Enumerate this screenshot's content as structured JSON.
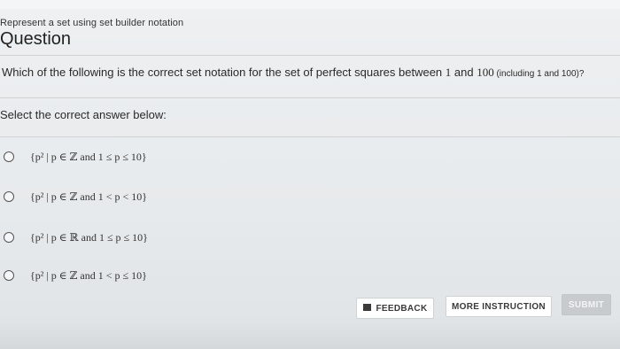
{
  "header": {
    "breadcrumb": "Represent a set using set builder notation",
    "title": "Question"
  },
  "question": {
    "text": "Which of the following is the correct set notation for the set of perfect squares between ",
    "range_start": "1",
    "and_word": " and ",
    "range_end": "100",
    "paren_text": " (including 1 and 100)?"
  },
  "prompt": "Select the correct answer below:",
  "choices": [
    {
      "label": "{p² | p ∈ ℤ and 1 ≤ p ≤ 10}"
    },
    {
      "label": "{p² | p ∈ ℤ and 1 < p < 10}"
    },
    {
      "label": "{p² | p ∈ ℝ and 1 ≤ p ≤ 10}"
    },
    {
      "label": "{p² | p ∈ ℤ and 1 < p ≤ 10}"
    }
  ],
  "buttons": {
    "feedback": "FEEDBACK",
    "more_instruction": "MORE INSTRUCTION",
    "submit": "SUBMIT"
  }
}
